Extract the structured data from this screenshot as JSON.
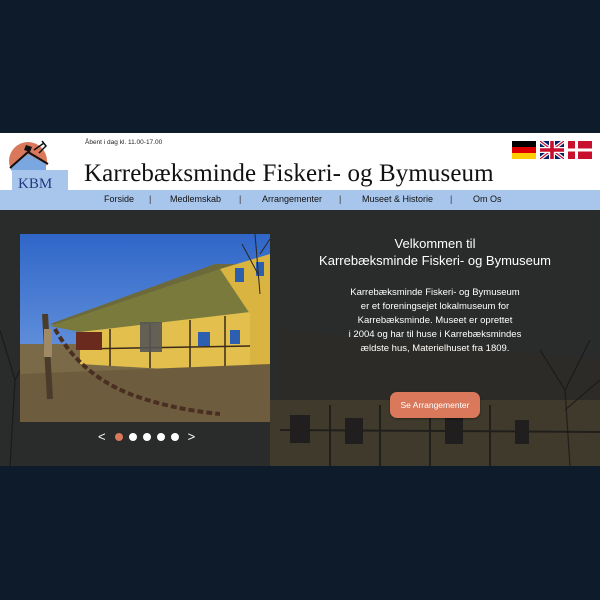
{
  "header": {
    "open_hours": "Åbent i dag kl. 11.00-17.00",
    "title": "Karrebæksminde Fiskeri- og Bymuseum",
    "logo_text": "KBM"
  },
  "languages": [
    {
      "name": "german-flag",
      "label": "Deutsch"
    },
    {
      "name": "english-flag",
      "label": "English"
    },
    {
      "name": "danish-flag",
      "label": "Dansk"
    }
  ],
  "nav": {
    "items": [
      "Forside",
      "Medlemskab",
      "Arrangementer",
      "Museet & Historie",
      "Om Os"
    ],
    "separator": "|"
  },
  "hero": {
    "heading_line1": "Velkommen til",
    "heading_line2": "Karrebæksminde Fiskeri- og Bymuseum",
    "text_lines": [
      "Karrebæksminde Fiskeri- og Bymuseum",
      "er et foreningsejet lokalmuseum for",
      "Karrebæksminde. Museet er oprettet",
      "i 2004 og har til huse i Karrebæksmindes",
      "ældste hus, Materielhuset fra 1809."
    ],
    "cta_label": "Se Arrangementer"
  },
  "carousel": {
    "prev": "<",
    "next": ">",
    "slide_count": 5,
    "active_index": 0
  },
  "colors": {
    "page_background": "#0d1b2a",
    "nav_background": "#a8c6ec",
    "accent": "#d9785a"
  }
}
